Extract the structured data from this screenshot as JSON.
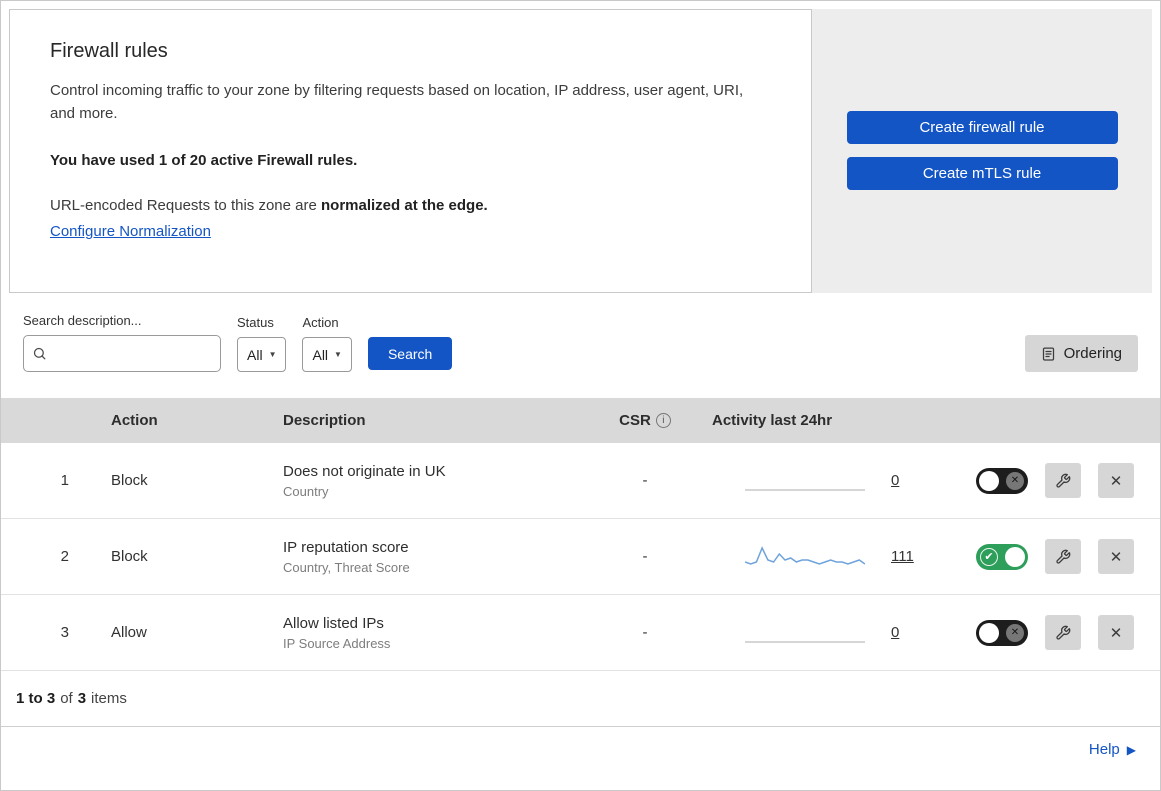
{
  "header": {
    "title": "Firewall rules",
    "description": "Control incoming traffic to your zone by filtering requests based on location, IP address, user agent, URI, and more.",
    "usage_line": "You have used 1 of 20 active Firewall rules.",
    "normalization_prefix": "URL-encoded Requests to this zone are ",
    "normalization_bold": "normalized at the edge.",
    "normalization_link": "Configure Normalization",
    "create_firewall_button": "Create firewall rule",
    "create_mtls_button": "Create mTLS rule"
  },
  "filters": {
    "search_label": "Search description...",
    "search_value": "",
    "status_label": "Status",
    "status_value": "All",
    "action_label": "Action",
    "action_value": "All",
    "search_button": "Search",
    "ordering_button": "Ordering"
  },
  "table": {
    "headers": {
      "action": "Action",
      "description": "Description",
      "csr": "CSR",
      "csr_info": "i",
      "activity": "Activity last 24hr"
    },
    "rows": [
      {
        "index": "1",
        "action": "Block",
        "description": "Does not originate in UK",
        "criteria": "Country",
        "csr": "-",
        "activity_count": "0",
        "enabled": false,
        "sparkline": [
          0,
          0
        ],
        "spark_color": "#c9c9c9"
      },
      {
        "index": "2",
        "action": "Block",
        "description": "IP reputation score",
        "criteria": "Country, Threat Score",
        "csr": "-",
        "activity_count": "111",
        "enabled": true,
        "sparkline": [
          2,
          1,
          2,
          9,
          3,
          2,
          6,
          3,
          4,
          2,
          3,
          3,
          2,
          1,
          2,
          3,
          2,
          2,
          1,
          2,
          3,
          1
        ],
        "spark_color": "#6ea3dc"
      },
      {
        "index": "3",
        "action": "Allow",
        "description": "Allow listed IPs",
        "criteria": "IP Source Address",
        "csr": "-",
        "activity_count": "0",
        "enabled": false,
        "sparkline": [
          0,
          0
        ],
        "spark_color": "#c9c9c9"
      }
    ]
  },
  "footer": {
    "range": "1 to 3",
    "of_label": "of",
    "total": "3",
    "items_label": "items",
    "help_label": "Help",
    "help_arrow": "▶"
  },
  "colors": {
    "accent": "#1455c5",
    "toggle_on_green": "#2e9e5b",
    "side_panel_bg": "#ededed",
    "table_header_bg": "#d9d9d9",
    "gray_button_bg": "#d6d6d6"
  }
}
